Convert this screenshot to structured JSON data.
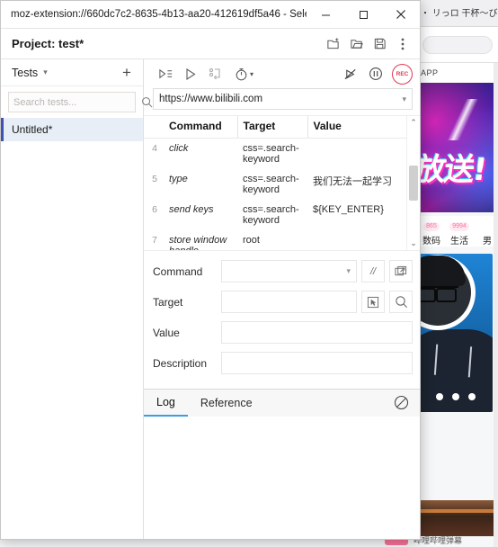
{
  "window": {
    "title": "moz-extension://660dc7c2-8635-4b13-aa20-412619df5a46 - Sele...",
    "minimize_label": "—",
    "maximize_label": "▭",
    "close_label": "✕"
  },
  "project_bar": {
    "label": "Project:  test*",
    "buttons": [
      {
        "name": "new-project-icon",
        "tooltip": "New project"
      },
      {
        "name": "open-project-icon",
        "tooltip": "Open project"
      },
      {
        "name": "save-project-icon",
        "tooltip": "Save project"
      },
      {
        "name": "more-menu-icon",
        "tooltip": "More options"
      }
    ]
  },
  "sidebar": {
    "title": "Tests",
    "caret": "▾",
    "add_label": "+",
    "search": {
      "placeholder": "Search tests...",
      "value": ""
    },
    "tests": [
      {
        "name": "Untitled*",
        "selected": true
      }
    ]
  },
  "controls": {
    "run_all_suites": "run-all-tests-icon",
    "run_current": "run-current-test-icon",
    "step_over": "step-icon",
    "speed": "speed-timer-icon",
    "speed_caret": "▾",
    "disable_breakpoints": "disable-breakpoints-icon",
    "pause": "pause-icon",
    "record_label": "REC"
  },
  "url_bar": {
    "value": "https://www.bilibili.com",
    "caret": "▾"
  },
  "command_table": {
    "headers": [
      "",
      "Command",
      "Target",
      "Value"
    ],
    "rows": [
      {
        "num": "4",
        "command": "click",
        "target": "css=.search-keyword",
        "value": ""
      },
      {
        "num": "5",
        "command": "type",
        "target": "css=.search-keyword",
        "value": "我们无法一起学习"
      },
      {
        "num": "6",
        "command": "send keys",
        "target": "css=.search-keyword",
        "value": "${KEY_ENTER}"
      },
      {
        "num": "7",
        "command": "store window handle",
        "target": "root",
        "value": ""
      }
    ],
    "scroll_up": "⌃",
    "scroll_down": "⌄"
  },
  "detail_form": {
    "command": {
      "label": "Command",
      "value": "",
      "caret": "▾"
    },
    "target": {
      "label": "Target",
      "value": ""
    },
    "value": {
      "label": "Value",
      "value": ""
    },
    "description": {
      "label": "Description",
      "value": ""
    },
    "buttons": {
      "comment": "//",
      "popout_icon": "open-in-window-icon",
      "select_target_icon": "select-target-icon",
      "find_target_icon": "find-target-icon"
    }
  },
  "log_panel": {
    "tabs": [
      {
        "label": "Log",
        "active": true
      },
      {
        "label": "Reference",
        "active": false
      }
    ],
    "clear_icon": "clear-log-icon",
    "content": ""
  },
  "background_page": {
    "tab_title": "・ リっロ 干杯～び",
    "app_label": "APP",
    "banner_text": "放送!",
    "categories": [
      {
        "badge": "865",
        "name": "数码"
      },
      {
        "badge": "9994",
        "name": "生活"
      },
      {
        "badge": "",
        "name": "男"
      }
    ],
    "bottom_text": "哔哩哔哩弹幕"
  },
  "colors": {
    "accent": "#3a9ee0",
    "record_red": "#e03a58",
    "selected_row": "#e8eef6",
    "selected_border": "#3f51b5",
    "bilibili_pink": "#fb7299"
  }
}
